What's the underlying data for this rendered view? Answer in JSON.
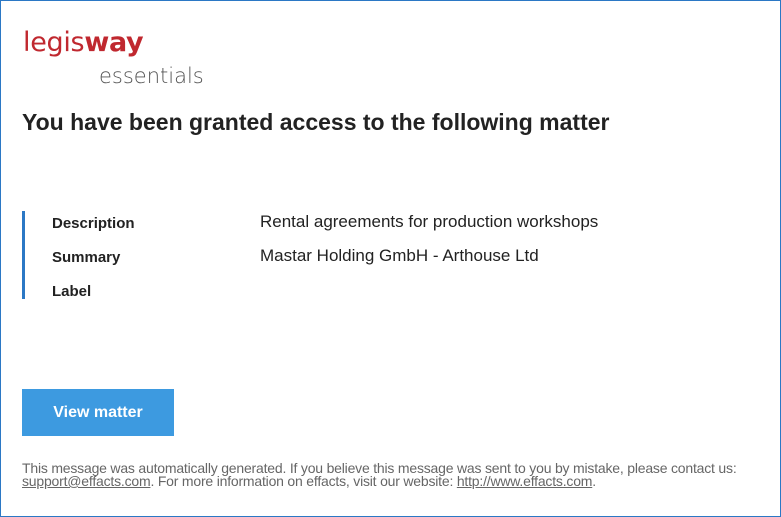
{
  "brand": {
    "logo_part1": "legis",
    "logo_part2": "way",
    "logo_sub": "essentials",
    "accent_color": "#c0282f",
    "border_color": "#2b78c5"
  },
  "headline": "You have been granted access to the following matter",
  "details": [
    {
      "label": "Description",
      "value": "Rental agreements for production workshops"
    },
    {
      "label": "Summary",
      "value": "Mastar Holding GmbH - Arthouse Ltd"
    },
    {
      "label": "Label",
      "value": ""
    }
  ],
  "button": {
    "label": "View matter",
    "color": "#3d9ae0"
  },
  "footer": {
    "text1": "This message was automatically generated. If you believe this message was sent to you by mistake, please contact us: ",
    "email": "support@effacts.com",
    "text2": ". For more information on effacts, visit our website: ",
    "website": "http://www.effacts.com",
    "text3": "."
  }
}
